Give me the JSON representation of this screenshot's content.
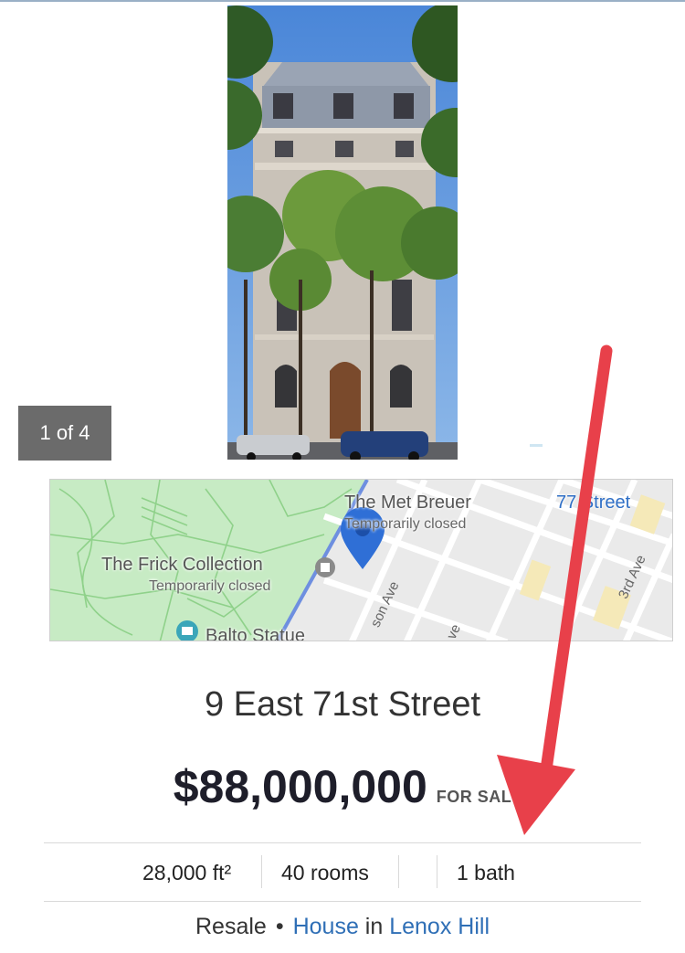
{
  "gallery": {
    "counter": "1 of 4"
  },
  "map": {
    "places": [
      {
        "name": "The Met Breuer",
        "note": "Temporarily closed"
      },
      {
        "name": "The Frick Collection",
        "note": "Temporarily closed"
      },
      {
        "name": "Balto Statue"
      },
      {
        "name": "77 Street"
      }
    ],
    "streets": [
      "son Ave",
      "3rd Ave",
      "ve"
    ]
  },
  "listing": {
    "address": "9 East 71st Street",
    "price": "$88,000,000",
    "status": "FOR SAL",
    "stats": {
      "area": "28,000 ft²",
      "rooms": "40 rooms",
      "beds": "",
      "baths": "1 bath"
    },
    "meta": {
      "sale_type": "Resale",
      "separator": "•",
      "property_type": "House",
      "in_word": "in",
      "neighborhood": "Lenox Hill"
    }
  },
  "colors": {
    "price": "#1e1e2a",
    "link": "#2f6fb6",
    "annotation_arrow": "#e8404a",
    "map_pin": "#2f6fd6",
    "park": "#c7ebc4"
  }
}
